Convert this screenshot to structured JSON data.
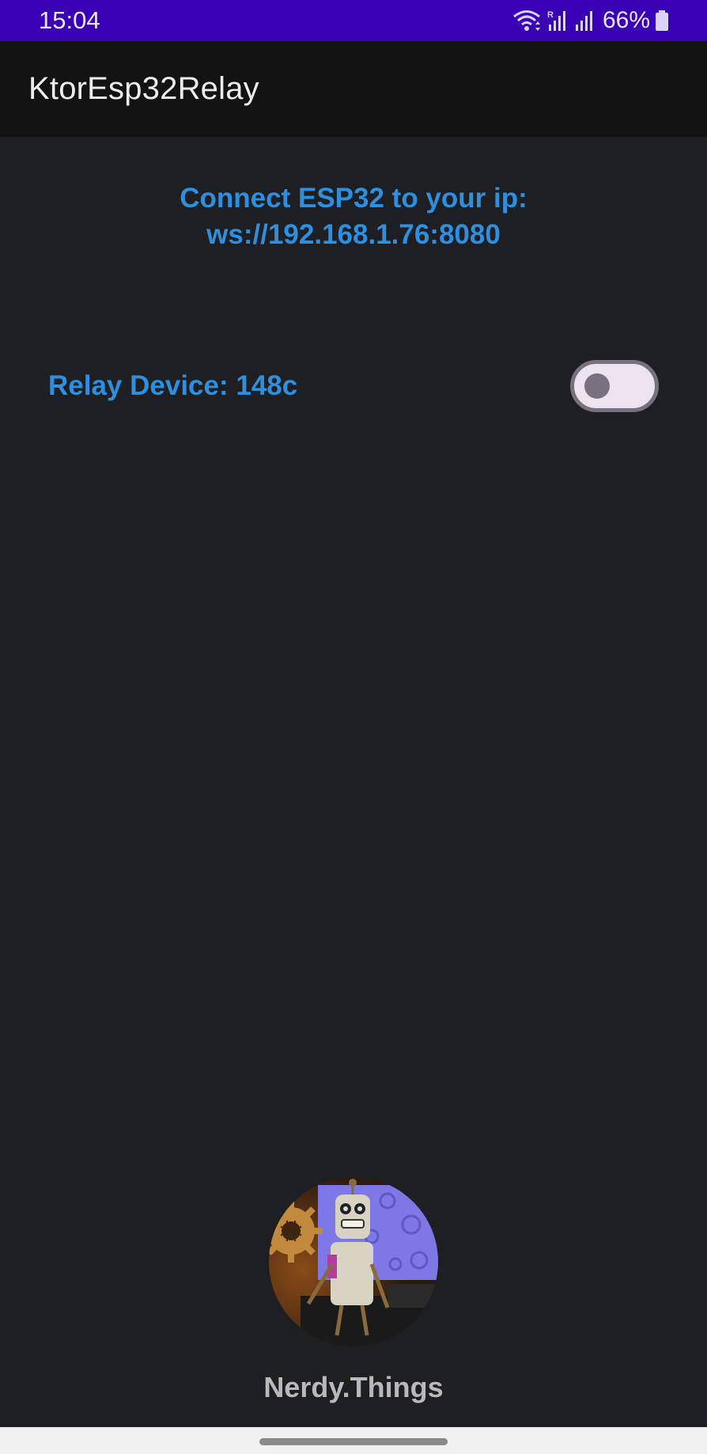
{
  "status_bar": {
    "time": "15:04",
    "battery": "66%",
    "icons": [
      "wifi-icon",
      "signal-roaming-icon",
      "signal-icon",
      "battery-icon"
    ]
  },
  "app_bar": {
    "title": "KtorEsp32Relay"
  },
  "main": {
    "connect_line1": "Connect ESP32 to your ip:",
    "connect_line2": "ws://192.168.1.76:8080",
    "relay": {
      "label": "Relay Device: 148c",
      "switch_on": false
    }
  },
  "footer": {
    "brand": "Nerdy.Things",
    "avatar_icon": "robot-avatar-icon"
  },
  "colors": {
    "status_bar": "#3a00b6",
    "app_bar": "#131313",
    "background": "#1e1f23",
    "accent_text": "#2f8fdf",
    "switch_track": "#ece3ee",
    "switch_thumb": "#77727d"
  }
}
